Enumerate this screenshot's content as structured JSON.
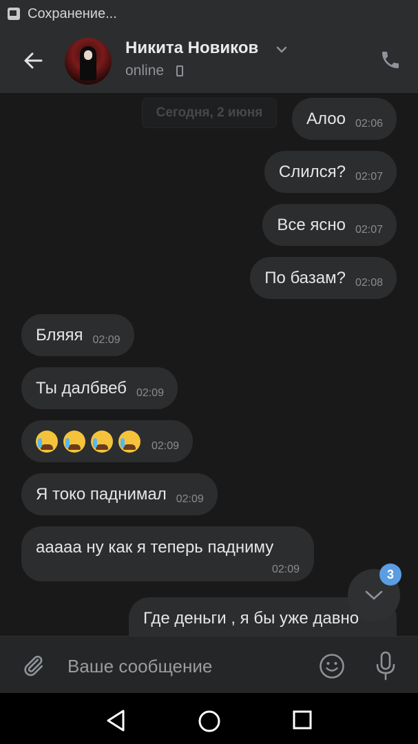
{
  "status_bar": {
    "text": "Сохранение...",
    "icon": "image-icon"
  },
  "header": {
    "contact_name": "Никита Новиков",
    "status": "online",
    "icons": [
      "back-arrow-icon",
      "chevron-down-icon",
      "mobile-icon",
      "phone-icon"
    ]
  },
  "chat": {
    "date_label": "Сегодня, 2 июня",
    "messages": [
      {
        "direction": "outgoing",
        "text": "Алоо",
        "time": "02:06"
      },
      {
        "direction": "outgoing",
        "text": "Слился?",
        "time": "02:07"
      },
      {
        "direction": "outgoing",
        "text": "Все ясно",
        "time": "02:07"
      },
      {
        "direction": "outgoing",
        "text": "По базам?",
        "time": "02:08"
      },
      {
        "direction": "incoming",
        "text": "Бляяя",
        "time": "02:09"
      },
      {
        "direction": "incoming",
        "text": "Ты далбвеб",
        "time": "02:09"
      },
      {
        "direction": "incoming",
        "text": "😭😭😭😭",
        "time": "02:09"
      },
      {
        "direction": "incoming",
        "text": "Я токо паднимал",
        "time": "02:09"
      },
      {
        "direction": "incoming",
        "text": "ааааа ну как я теперь падниму",
        "time": "02:09"
      },
      {
        "direction": "outgoing",
        "text": "Где деньги , я бы уже давно",
        "time": ""
      }
    ],
    "unread_count": "3"
  },
  "composer": {
    "placeholder": "Ваше сообщение",
    "value": "",
    "icons": [
      "paperclip-icon",
      "smiley-icon",
      "microphone-icon"
    ]
  },
  "navbar": {
    "icons": [
      "nav-back-icon",
      "nav-home-icon",
      "nav-recents-icon"
    ]
  },
  "colors": {
    "background": "#19191a",
    "bar": "#2c2d2e",
    "bubble": "#2c2d2e",
    "badge": "#5a9de2"
  }
}
